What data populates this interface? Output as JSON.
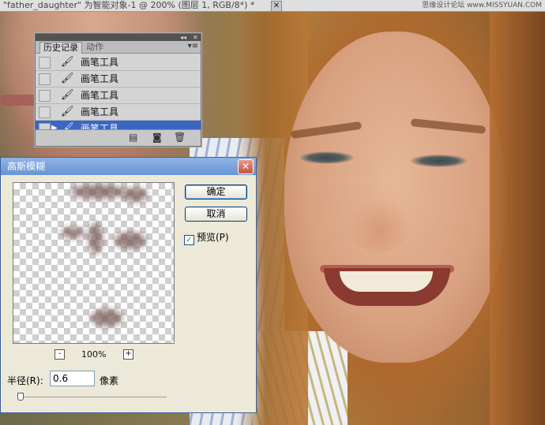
{
  "document": {
    "tab_title": "\"father_daughter\" 为智能对象-1 @ 200% (图层 1, RGB/8*) *",
    "close_glyph": "✕",
    "watermark": "思缘设计论坛 www.MISSYUAN.COM"
  },
  "history_panel": {
    "collapse_glyph": "◂◂",
    "close_glyph": "✕",
    "tabs": [
      {
        "label": "历史记录",
        "active": true
      },
      {
        "label": "动作",
        "active": false
      }
    ],
    "menu_glyph": "▾≡",
    "rows": [
      {
        "label": "画笔工具",
        "icon": "brush-icon",
        "active": false
      },
      {
        "label": "画笔工具",
        "icon": "brush-icon",
        "active": false
      },
      {
        "label": "画笔工具",
        "icon": "brush-icon",
        "active": false
      },
      {
        "label": "画笔工具",
        "icon": "brush-icon",
        "active": false
      },
      {
        "label": "画笔工具",
        "icon": "brush-icon",
        "active": true
      }
    ],
    "brush_glyph": "🖌",
    "active_arrow": "▶",
    "footer_icons": [
      "new-document-from-state-icon",
      "new-snapshot-icon",
      "delete-icon"
    ],
    "footer_glyphs": [
      "▤",
      "◙",
      "🗑"
    ]
  },
  "gaussian_blur": {
    "title": "高斯模糊",
    "close_glyph": "✕",
    "ok_label": "确定",
    "cancel_label": "取消",
    "preview_label": "预览(P)",
    "preview_checked": true,
    "check_glyph": "✓",
    "zoom_out_glyph": "-",
    "zoom_in_glyph": "+",
    "zoom_value": "100%",
    "radius_label": "半径(R):",
    "radius_value": "0.6",
    "radius_unit": "像素"
  },
  "colors": {
    "dialog_title_bar": "#6a95d2",
    "history_selected_row": "#3a66c4",
    "close_button": "#c5533f"
  }
}
